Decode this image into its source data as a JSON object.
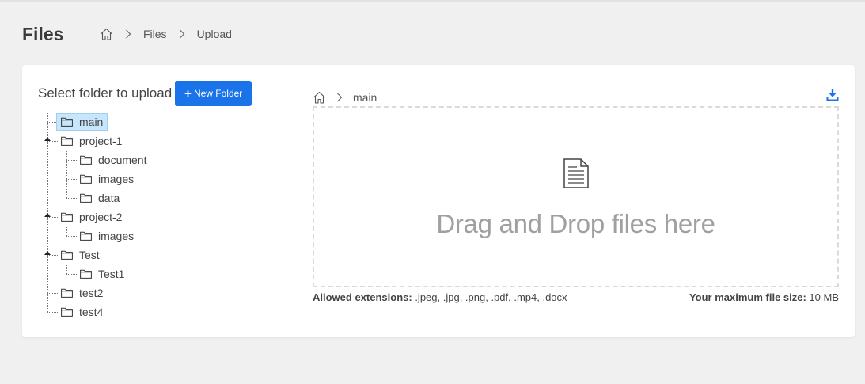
{
  "page": {
    "title": "Files",
    "breadcrumb": {
      "home_icon": "home-icon",
      "items": [
        "Files",
        "Upload"
      ]
    }
  },
  "upload_panel": {
    "select_label": "Select folder to upload",
    "new_folder_button": {
      "icon": "plus",
      "label": "New Folder"
    },
    "tree": [
      {
        "label": "main",
        "selected": true
      },
      {
        "label": "project-1",
        "expanded": true
      },
      {
        "label": "document"
      },
      {
        "label": "images"
      },
      {
        "label": "data"
      },
      {
        "label": "project-2",
        "expanded": true
      },
      {
        "label": "images"
      },
      {
        "label": "Test",
        "expanded": true
      },
      {
        "label": "Test1"
      },
      {
        "label": "test2"
      },
      {
        "label": "test4"
      }
    ]
  },
  "dropzone": {
    "path": {
      "home_icon": "home-icon",
      "current": "main"
    },
    "download_icon": "download-icon",
    "file_icon": "document-icon",
    "text": "Drag and Drop files here"
  },
  "footer": {
    "extensions_label": "Allowed extensions:",
    "extensions_value": " .jpeg, .jpg, .png, .pdf, .mp4, .docx",
    "max_size_label": "Your maximum file size:",
    "max_size_value": " 10 MB"
  },
  "colors": {
    "accent": "#1a73e8",
    "selected_bg": "#c8e6fb",
    "background": "#f0f0f0"
  }
}
